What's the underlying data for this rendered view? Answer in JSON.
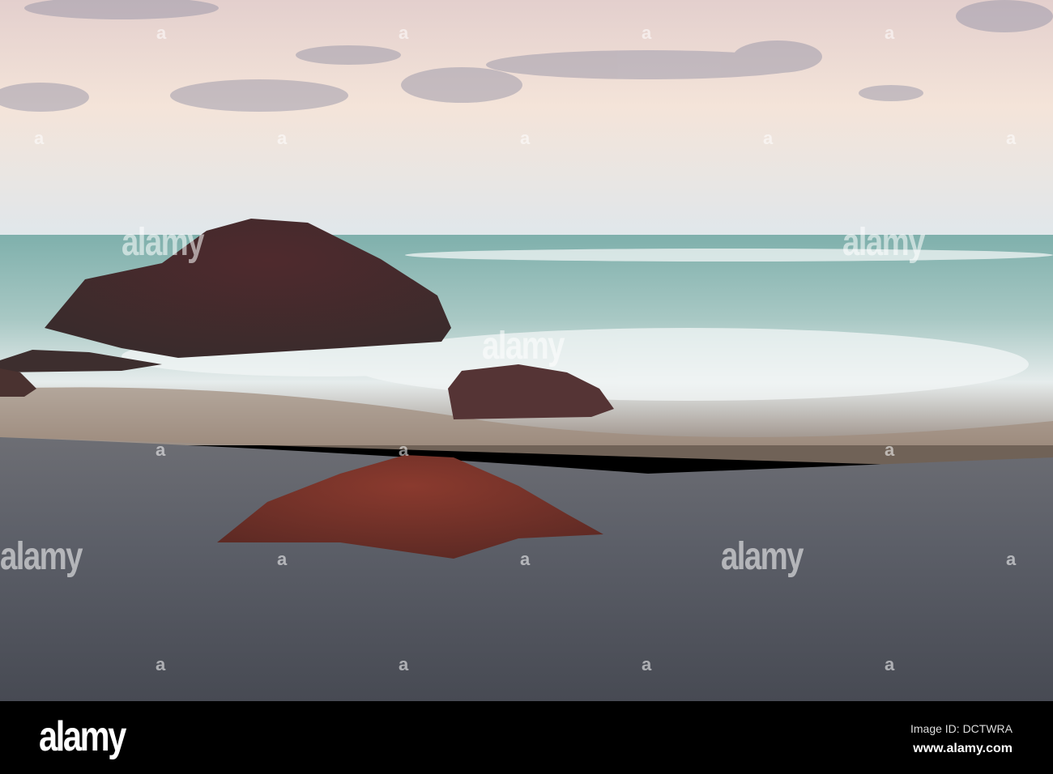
{
  "watermark": {
    "text": "alamy",
    "mark": "a"
  },
  "footer": {
    "logo": "alamy",
    "image_id": "Image ID: DCTWRA",
    "url": "www.alamy.com"
  },
  "colors": {
    "sky_top": "#e6d3cf",
    "sky_horizon": "#e2e8ec",
    "sea": "#8fb8b2",
    "sand": "#585b64",
    "rock_dark": "#4a2c2e",
    "rock_red": "#7c3329"
  }
}
